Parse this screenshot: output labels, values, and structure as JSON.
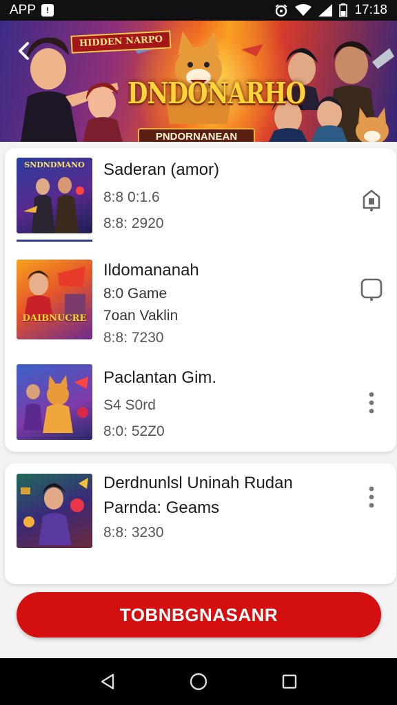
{
  "status_bar": {
    "app_label": "APP",
    "time": "17:18"
  },
  "banner": {
    "badge": "HIDDEN NARPO",
    "title": "DNDONARHO",
    "subtitle": "PNDORNANEAN"
  },
  "items": [
    {
      "thumb_title": "SNDNDMANO",
      "title": "Saderan (amor)",
      "lines": [
        "8:8 0:1.6",
        "8:8: 2920"
      ],
      "action_icon": "share-icon"
    },
    {
      "thumb_title": "DAIBNUCRE",
      "title": "Ildomananah",
      "lines": [
        "8:0 Game",
        "7oan Vaklin",
        "8:8: 7230"
      ],
      "action_icon": "tablet-icon"
    },
    {
      "thumb_title": "",
      "title": "Paclantan Gim.",
      "lines": [
        "S4 S0rd",
        "8:0: 52Z0"
      ],
      "action_icon": "more-vertical-icon"
    },
    {
      "thumb_title": "",
      "title": "Derdnunlsl Uninah Rudan",
      "lines": [
        "Parnda: Geams",
        "8:8: 3230"
      ],
      "action_icon": "more-vertical-icon"
    }
  ],
  "cta": {
    "label": "TOBNBGNASANR"
  },
  "colors": {
    "accent": "#d40f0f",
    "card_bg": "#ffffff",
    "page_bg": "#f3f3f4",
    "status_bar": "#111111",
    "nav_bar": "#000000"
  }
}
